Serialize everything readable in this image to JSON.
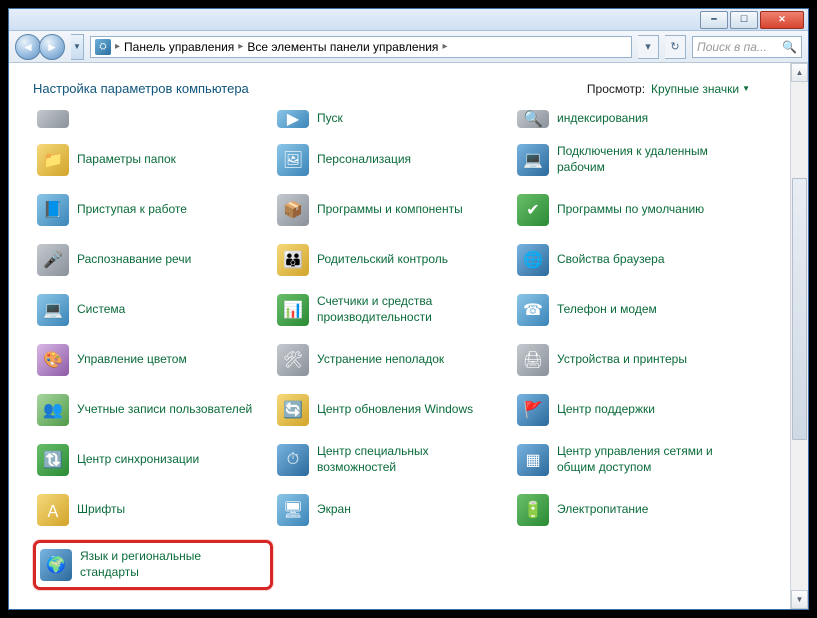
{
  "breadcrumbs": [
    "Панель управления",
    "Все элементы панели управления"
  ],
  "search": {
    "placeholder": "Поиск в па..."
  },
  "heading": "Настройка параметров компьютера",
  "view": {
    "label": "Просмотр:",
    "value": "Крупные значки"
  },
  "items": [
    {
      "label": ""
    },
    {
      "label": "Пуск"
    },
    {
      "label": "индексирования"
    },
    {
      "label": "Параметры папок"
    },
    {
      "label": "Персонализация"
    },
    {
      "label": "Подключения к удаленным рабочим"
    },
    {
      "label": "Приступая к работе"
    },
    {
      "label": "Программы и компоненты"
    },
    {
      "label": "Программы по умолчанию"
    },
    {
      "label": "Распознавание речи"
    },
    {
      "label": "Родительский контроль"
    },
    {
      "label": "Свойства браузера"
    },
    {
      "label": "Система"
    },
    {
      "label": "Счетчики и средства производительности"
    },
    {
      "label": "Телефон и модем"
    },
    {
      "label": "Управление цветом"
    },
    {
      "label": "Устранение неполадок"
    },
    {
      "label": "Устройства и принтеры"
    },
    {
      "label": "Учетные записи пользователей"
    },
    {
      "label": "Центр обновления Windows"
    },
    {
      "label": "Центр поддержки"
    },
    {
      "label": "Центр синхронизации"
    },
    {
      "label": "Центр специальных возможностей"
    },
    {
      "label": "Центр управления сетями и общим доступом"
    },
    {
      "label": "Шрифты"
    },
    {
      "label": "Экран"
    },
    {
      "label": "Электропитание"
    },
    {
      "label": "Язык и региональные стандарты"
    }
  ]
}
